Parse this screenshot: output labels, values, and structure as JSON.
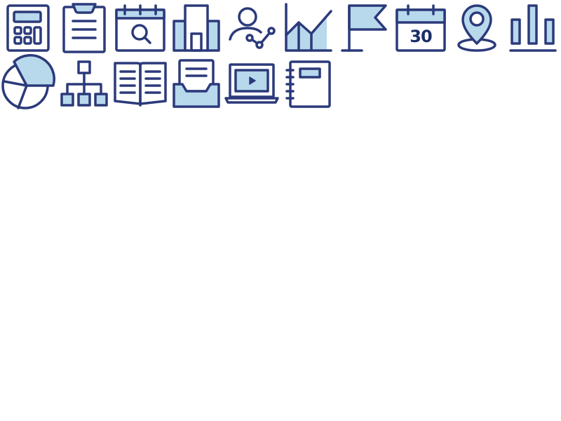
{
  "colors": {
    "stroke": "#2b3a7a",
    "fill": "#b8d8ec",
    "background": "#ffffff"
  },
  "icons": [
    {
      "name": "calculator-icon"
    },
    {
      "name": "clipboard-icon"
    },
    {
      "name": "calendar-search-icon"
    },
    {
      "name": "buildings-icon"
    },
    {
      "name": "user-analytics-icon"
    },
    {
      "name": "area-chart-icon"
    },
    {
      "name": "flag-icon"
    },
    {
      "name": "calendar-date-icon"
    },
    {
      "name": "location-pin-icon"
    },
    {
      "name": "bar-chart-icon"
    },
    {
      "name": "pie-chart-icon"
    },
    {
      "name": "org-chart-icon"
    },
    {
      "name": "open-book-icon"
    },
    {
      "name": "inbox-tray-icon"
    },
    {
      "name": "laptop-video-icon"
    },
    {
      "name": "notebook-icon"
    }
  ],
  "calendar_date": {
    "day": "30"
  }
}
